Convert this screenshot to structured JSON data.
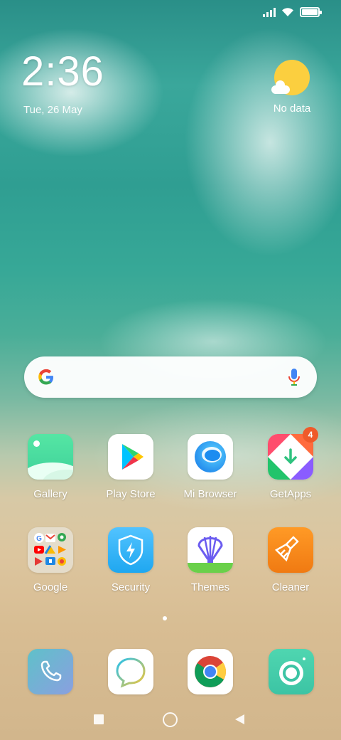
{
  "status_bar": {
    "signal_icon": "signal-icon",
    "wifi_icon": "wifi-icon",
    "battery_icon": "battery-icon",
    "battery_level": 1.0
  },
  "clock": {
    "time": "2:36",
    "date": "Tue, 26 May"
  },
  "weather": {
    "icon": "partly-cloudy-icon",
    "text": "No data"
  },
  "search_bar": {
    "logo": "google-g-icon",
    "mic": "mic-icon"
  },
  "apps": [
    {
      "label": "Gallery",
      "icon": "gallery-icon"
    },
    {
      "label": "Play Store",
      "icon": "play-store-icon"
    },
    {
      "label": "Mi Browser",
      "icon": "mi-browser-icon"
    },
    {
      "label": "GetApps",
      "icon": "getapps-icon",
      "badge": "4"
    },
    {
      "label": "Google",
      "icon": "google-folder-icon"
    },
    {
      "label": "Security",
      "icon": "security-icon"
    },
    {
      "label": "Themes",
      "icon": "themes-icon"
    },
    {
      "label": "Cleaner",
      "icon": "cleaner-icon"
    }
  ],
  "dock": [
    {
      "icon": "phone-icon"
    },
    {
      "icon": "messages-icon"
    },
    {
      "icon": "chrome-icon"
    },
    {
      "icon": "camera-icon"
    }
  ],
  "nav": {
    "recents": "recents-icon",
    "home": "home-icon",
    "back": "back-icon"
  },
  "colors": {
    "badge": "#ef5a2a",
    "sun": "#fbcf3f"
  }
}
